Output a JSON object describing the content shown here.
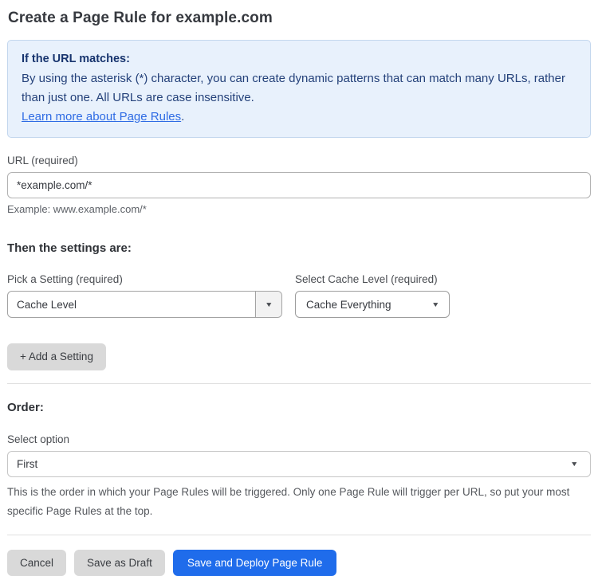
{
  "page": {
    "title": "Create a Page Rule for example.com"
  },
  "info_box": {
    "heading": "If the URL matches:",
    "body": "By using the asterisk (*) character, you can create dynamic patterns that can match many URLs, rather than just one. All URLs are case insensitive.",
    "link_label": "Learn more about Page Rules",
    "link_suffix": "."
  },
  "url_field": {
    "label": "URL (required)",
    "value": "*example.com/*",
    "helper": "Example: www.example.com/*"
  },
  "settings_section": {
    "heading": "Then the settings are:",
    "setting_picker": {
      "label": "Pick a Setting (required)",
      "value": "Cache Level"
    },
    "cache_level_picker": {
      "label": "Select Cache Level (required)",
      "value": "Cache Everything"
    },
    "add_setting_label": "+ Add a Setting"
  },
  "order_section": {
    "heading": "Order:",
    "label": "Select option",
    "value": "First",
    "helper": "This is the order in which your Page Rules will be triggered. Only one Page Rule will trigger per URL, so put your most specific Page Rules at the top."
  },
  "footer": {
    "cancel_label": "Cancel",
    "save_draft_label": "Save as Draft",
    "save_deploy_label": "Save and Deploy Page Rule"
  },
  "icons": {
    "dropdown_arrow": "▼"
  },
  "colors": {
    "primary_button": "#1f6ceb",
    "info_box_background": "#e8f1fc",
    "info_box_border": "#c3d7ee",
    "info_box_text": "#24417a",
    "link": "#2e6be4",
    "gray_button": "#d9d9d9"
  }
}
